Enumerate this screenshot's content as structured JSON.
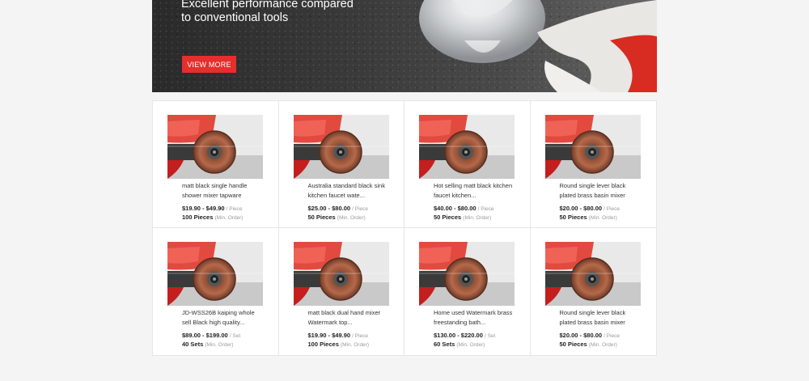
{
  "banner": {
    "title": "Excellent performance compared to conventional tools",
    "button_label": "VIEW MORE",
    "accent_color": "#e62e2d"
  },
  "products": [
    {
      "title": "matt black single handle shower mixer tapware",
      "price": "$19.90 - $49.90",
      "unit": "/ Piece",
      "moq": "100 Pieces",
      "moq_note": "(Min. Order)"
    },
    {
      "title": "Australia standard black sink kitchen faucet wate...",
      "price": "$25.00 - $80.00",
      "unit": "/ Piece",
      "moq": "50 Pieces",
      "moq_note": "(Min. Order)"
    },
    {
      "title": "Hot selling matt black kitchen faucet kitchen...",
      "price": "$40.00 - $80.00",
      "unit": "/ Piece",
      "moq": "50 Pieces",
      "moq_note": "(Min. Order)"
    },
    {
      "title": "Round single lever black plated brass basin mixer",
      "price": "$20.00 - $80.00",
      "unit": "/ Piece",
      "moq": "50 Pieces",
      "moq_note": "(Min. Order)"
    },
    {
      "title": "JD-WSS26B kaiping whole sell Black high quality...",
      "price": "$89.00 - $199.00",
      "unit": "/ Set",
      "moq": "40 Sets",
      "moq_note": "(Min. Order)"
    },
    {
      "title": "matt black dual hand mixer Watermark top...",
      "price": "$19.90 - $49.90",
      "unit": "/ Piece",
      "moq": "100 Pieces",
      "moq_note": "(Min. Order)"
    },
    {
      "title": "Home used Watermark brass freestanding bath...",
      "price": "$130.00 - $220.00",
      "unit": "/ Set",
      "moq": "60 Sets",
      "moq_note": "(Min. Order)"
    },
    {
      "title": "Round single lever black plated brass basin mixer",
      "price": "$20.00 - $80.00",
      "unit": "/ Piece",
      "moq": "50 Pieces",
      "moq_note": "(Min. Order)"
    }
  ]
}
